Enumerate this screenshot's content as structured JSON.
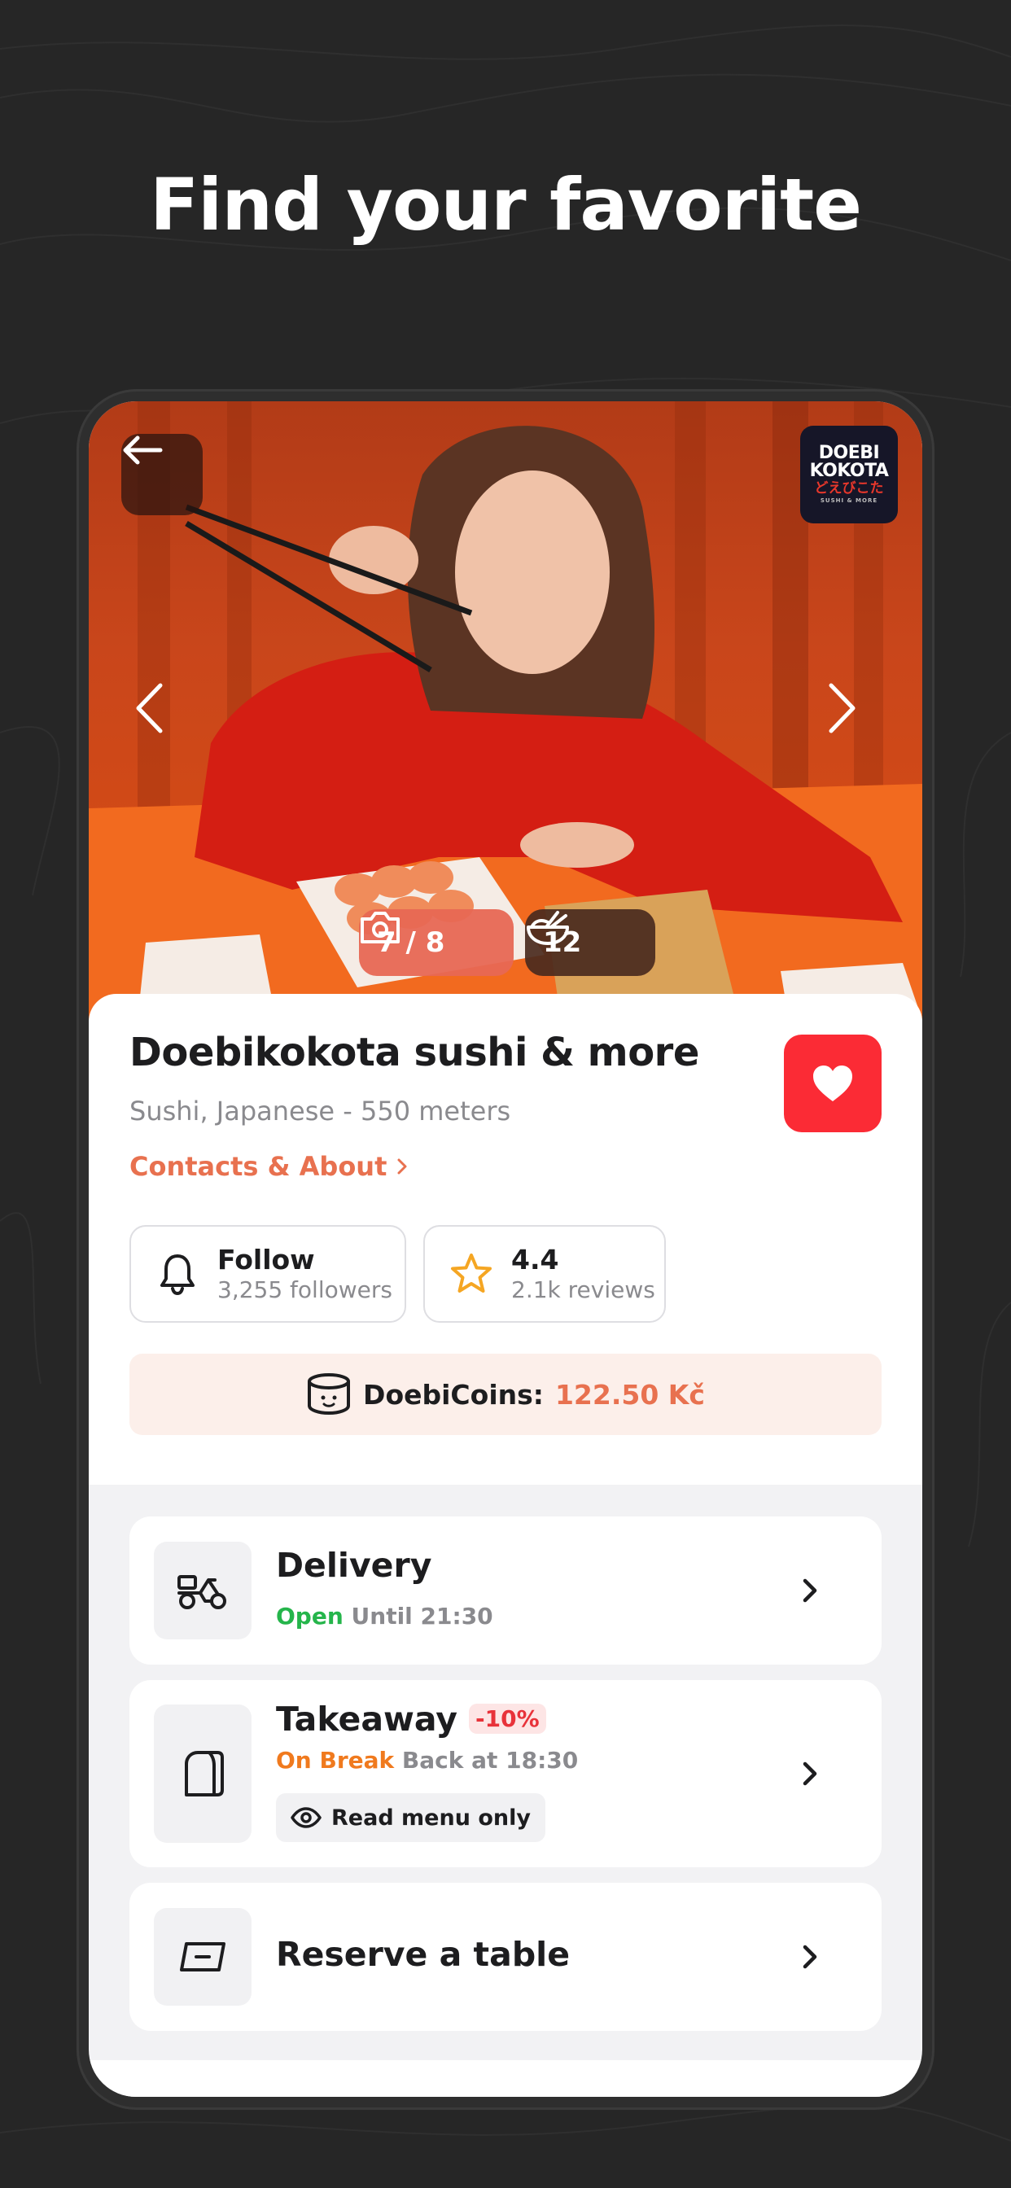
{
  "headline": "Find your favorite",
  "hero": {
    "photo_counter": "7 / 8",
    "dishes_count": "12"
  },
  "logo": {
    "line1": "DOEBI",
    "line2": "KOKOTA",
    "line3": "どえびこた",
    "line4": "SUSHI & MORE"
  },
  "restaurant": {
    "name": "Doebikokota sushi & more",
    "subtitle": "Sushi, Japanese - 550 meters",
    "contacts_link": "Contacts & About"
  },
  "follow": {
    "label": "Follow",
    "followers": "3,255 followers"
  },
  "rating": {
    "value": "4.4",
    "reviews": "2.1k reviews"
  },
  "coins": {
    "label": "DoebiCoins:",
    "value": "122.50 Kč"
  },
  "options": {
    "delivery": {
      "title": "Delivery",
      "status": "Open",
      "detail": "Until 21:30"
    },
    "takeaway": {
      "title": "Takeaway",
      "discount": "-10%",
      "status": "On Break",
      "detail": "Back at 18:30",
      "menu_button": "Read menu only"
    },
    "reserve": {
      "title": "Reserve a table"
    }
  },
  "colors": {
    "accent": "#e8714f",
    "favorite": "#fb2b35",
    "open": "#25b54b",
    "on_break": "#f07a1e"
  }
}
